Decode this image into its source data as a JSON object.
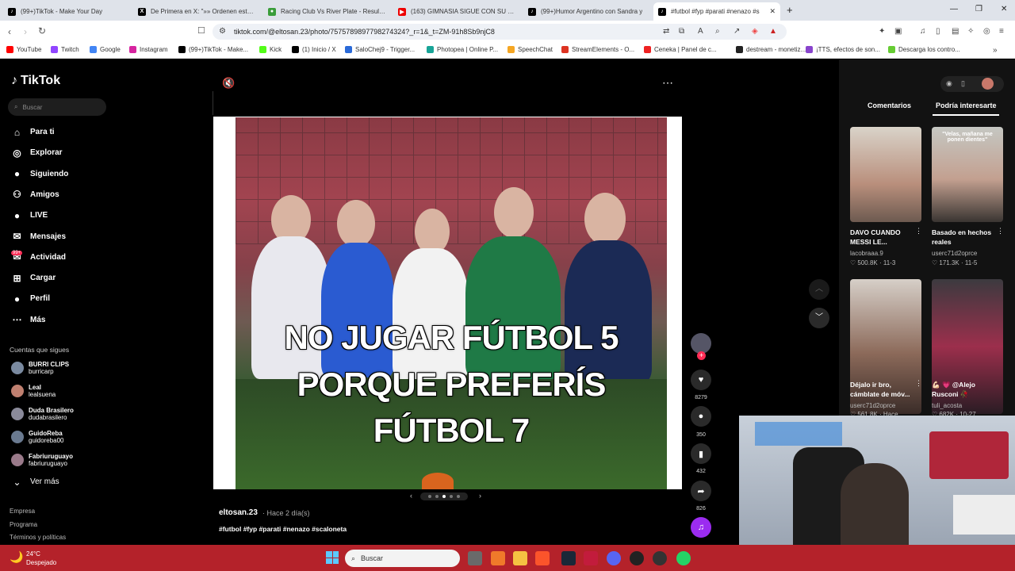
{
  "tabs": [
    {
      "label": "(99+)TikTok - Make Your Day",
      "color": "#000"
    },
    {
      "label": "De Primera en X: \"»» Ordenen estos»",
      "color": "#000"
    },
    {
      "label": "Racing Club Vs River Plate - Resultad",
      "color": "#3a9d3a"
    },
    {
      "label": "(163) GIMNASIA SIGUE CON SU RAC",
      "color": "#e00"
    },
    {
      "label": "(99+)Humor Argentino con Sandra y",
      "color": "#000"
    },
    {
      "label": "#futbol #fyp #parati #nenazo #s",
      "color": "#000"
    }
  ],
  "url": "tiktok.com/@eltosan.23/photo/7575789897798274324?_r=1&_t=ZM-91h8Sb9njC8",
  "bookmarks": [
    {
      "label": "YouTube",
      "color": "#f00"
    },
    {
      "label": "Twitch",
      "color": "#9146ff"
    },
    {
      "label": "Google",
      "color": "#4285f4"
    },
    {
      "label": "Instagram",
      "color": "#d6249f"
    },
    {
      "label": "(99+)TikTok - Make...",
      "color": "#000"
    },
    {
      "label": "Kick",
      "color": "#53fc18"
    },
    {
      "label": "(1) Inicio / X",
      "color": "#000"
    },
    {
      "label": "SaloChej9 - Trigger...",
      "color": "#2a6ad8"
    },
    {
      "label": "Photopea | Online P...",
      "color": "#18a497"
    },
    {
      "label": "SpeechChat",
      "color": "#f5a623"
    },
    {
      "label": "StreamElements - O...",
      "color": "#d32"
    },
    {
      "label": "Ceneka | Panel de c...",
      "color": "#e22"
    },
    {
      "label": "destream - monetiz...",
      "color": "#222"
    },
    {
      "label": "¡TTS, efectos de son...",
      "color": "#8844cc"
    },
    {
      "label": "Descarga los contro...",
      "color": "#6c3"
    }
  ],
  "sidebar": {
    "logo": "TikTok",
    "search_placeholder": "Buscar",
    "items": [
      {
        "label": "Para ti",
        "icon": "home-icon"
      },
      {
        "label": "Explorar",
        "icon": "compass-icon"
      },
      {
        "label": "Siguiendo",
        "icon": "following-icon"
      },
      {
        "label": "Amigos",
        "icon": "friends-icon"
      },
      {
        "label": "LIVE",
        "icon": "live-icon"
      },
      {
        "label": "Mensajes",
        "icon": "message-icon"
      },
      {
        "label": "Actividad",
        "icon": "activity-icon"
      },
      {
        "label": "Cargar",
        "icon": "upload-icon"
      },
      {
        "label": "Perfil",
        "icon": "profile-icon"
      },
      {
        "label": "Más",
        "icon": "more-icon"
      }
    ],
    "badge_activity": "99+",
    "following_title": "Cuentas que sigues",
    "following": [
      {
        "name": "BURRI CLIPS",
        "handle": "burricarp"
      },
      {
        "name": "Leal",
        "handle": "lealsuena"
      },
      {
        "name": "Duda Brasilero",
        "handle": "dudabrasilero"
      },
      {
        "name": "GuidoReba",
        "handle": "guidoreba00"
      },
      {
        "name": "Fabriuruguayo",
        "handle": "fabriuruguayo"
      }
    ],
    "see_more": "Ver más",
    "footer": [
      "Empresa",
      "Programa",
      "Términos y políticas"
    ]
  },
  "post": {
    "overlay_lines": [
      "NO JUGAR FÚTBOL 5",
      "PORQUE PREFERÍS",
      "FÚTBOL 7"
    ],
    "author": "eltosan.23",
    "time": "· Hace 2 día(s)",
    "caption": "#futbol #fyp #parati #nenazo #scaloneta",
    "likes": "8279",
    "comments": "350",
    "saves": "432",
    "shares": "826"
  },
  "right": {
    "tabs": [
      "Comentarios",
      "Podría interesarte"
    ],
    "videos": [
      {
        "title": "DAVO CUANDO MESSI LE...",
        "author": "lacobraaa.9",
        "views": "500.8K",
        "date": "11-3",
        "thumb_text": ""
      },
      {
        "title": "Basado en hechos reales",
        "author": "userc71d2oprce",
        "views": "171.3K",
        "date": "11-5",
        "thumb_text": "\"Velas, mañana me ponen dientes\""
      },
      {
        "title": "Déjalo ir bro, cámblate de móv...",
        "author": "userc71d2oprce",
        "views": "561.8K",
        "date": "Hace...",
        "thumb_text": ""
      },
      {
        "title": "💪🏻 💗 @Alejo Rusconi 🥀",
        "author": "tuli_acosta",
        "views": "682K",
        "date": "10-27",
        "thumb_text": ""
      }
    ]
  },
  "taskbar": {
    "temp": "24°C",
    "weather": "Despejado",
    "search": "Buscar"
  }
}
